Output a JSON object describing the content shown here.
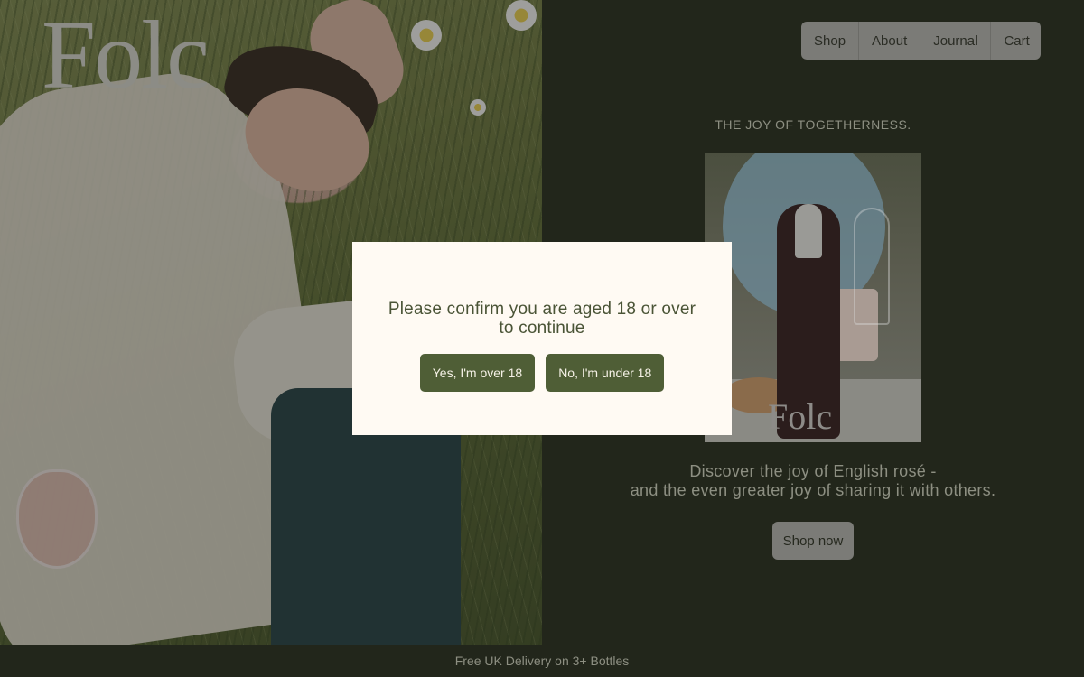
{
  "brand": {
    "logo_text": "Folc"
  },
  "nav": {
    "items": [
      {
        "label": "Shop"
      },
      {
        "label": "About"
      },
      {
        "label": "Journal"
      },
      {
        "label": "Cart"
      }
    ]
  },
  "hero": {
    "tagline": "THE JOY OF TOGETHERNESS.",
    "product_label": "Folc",
    "description_line1": "Discover the joy of English rosé -",
    "description_line2": "and the even greater joy of sharing it with others.",
    "cta_label": "Shop now"
  },
  "footer": {
    "text": "Free UK Delivery on 3+ Bottles"
  },
  "age_gate": {
    "message": "Please confirm you are aged 18 or over to continue",
    "yes_label": "Yes, I'm over 18",
    "no_label": "No, I'm under 18"
  },
  "colors": {
    "page_background": "#22261b",
    "modal_background": "#fffaf3",
    "modal_button": "#4f5e36",
    "nav_background": "#7b7b77"
  }
}
